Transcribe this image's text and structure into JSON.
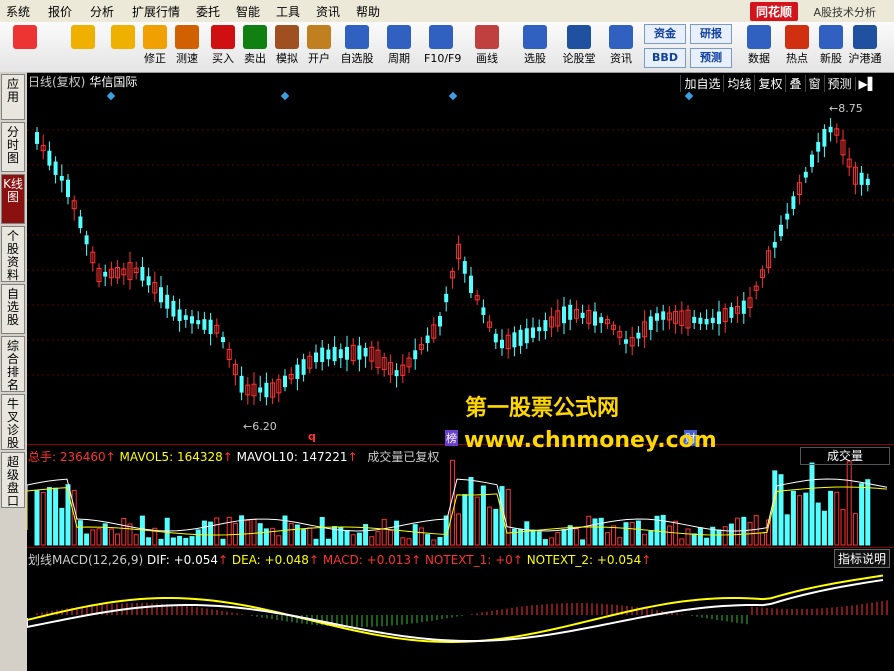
{
  "menu": [
    "系统",
    "报价",
    "分析",
    "扩展行情",
    "委托",
    "智能",
    "工具",
    "资讯",
    "帮助"
  ],
  "brand": "同花顺",
  "app_title": "A股技术分析",
  "toolbar": [
    {
      "label": "",
      "icon": "grid-icon",
      "color": "#e33"
    },
    {
      "label": "",
      "icon": "back-arrow-icon",
      "color": "#f0b000"
    },
    {
      "label": "",
      "icon": "up-down-arrow-icon",
      "color": "#f0b000"
    },
    {
      "label": "修正",
      "icon": "refresh-icon",
      "color": "#f0a000"
    },
    {
      "label": "测速",
      "icon": "clock-icon",
      "color": "#d06000"
    },
    {
      "label": "买入",
      "icon": "buy-icon",
      "color": "#d01010"
    },
    {
      "label": "卖出",
      "icon": "sell-icon",
      "color": "#108010"
    },
    {
      "label": "模拟",
      "icon": "hammer-icon",
      "color": "#a05020"
    },
    {
      "label": "开户",
      "icon": "lock-icon",
      "color": "#c08020"
    },
    {
      "label": "自选股",
      "icon": "star-folder-icon",
      "color": "#3060c0"
    },
    {
      "label": "周期",
      "icon": "period-icon",
      "color": "#3060c0"
    },
    {
      "label": "F10/F9",
      "icon": "f10-icon",
      "color": "#3060c0"
    },
    {
      "label": "画线",
      "icon": "pencil-icon",
      "color": "#c04040"
    },
    {
      "label": "选股",
      "icon": "filter-icon",
      "color": "#3060c0"
    },
    {
      "label": "论股堂",
      "icon": "forum-icon",
      "color": "#2050a0"
    },
    {
      "label": "资讯",
      "icon": "news-icon",
      "color": "#3060c0"
    },
    {
      "label": "数据",
      "icon": "pe-icon",
      "color": "#3060c0"
    },
    {
      "label": "热点",
      "icon": "hot-icon",
      "color": "#d03010"
    },
    {
      "label": "新股",
      "icon": "new-stock-icon",
      "color": "#3060c0"
    },
    {
      "label": "沪港通",
      "icon": "sse-hke-icon",
      "color": "#2050a0"
    }
  ],
  "toolbar_small": {
    "zijin": "资金",
    "bbd": "BBD",
    "yanbao": "研报",
    "yuce": "预测"
  },
  "sidebar": [
    {
      "label": "应用"
    },
    {
      "label": "分时图"
    },
    {
      "label": "K线图",
      "active": true
    },
    {
      "label": "个股资料"
    },
    {
      "label": "自选股"
    },
    {
      "label": "综合排名"
    },
    {
      "label": "牛叉诊股"
    },
    {
      "label": "超级盘口"
    }
  ],
  "chart": {
    "period": "日线(复权)",
    "stock_name": "华信国际",
    "buttons": [
      "加自选",
      "均线",
      "复权",
      "叠",
      "窗",
      "预测"
    ],
    "high_label": "8.75",
    "low_label": "6.20",
    "marker_q": "q",
    "marker_bang": "榜",
    "marker_cai": "财"
  },
  "volume": {
    "total_label": "总手: 236460",
    "mavol5": "MAVOL5: 164328",
    "mavol10": "MAVOL10: 147221",
    "note": "成交量已复权",
    "selector": "成交量"
  },
  "macd": {
    "title": "划线MACD(12,26,9)",
    "dif": "DIF: +0.054",
    "dea": "DEA: +0.048",
    "macd": "MACD: +0.013",
    "notext1": "NOTEXT_1: +0",
    "notext2": "NOTEXT_2: +0.054",
    "indicator_btn": "指标说明"
  },
  "watermark": {
    "line1": "第一股票公式网",
    "line2": "www.chnmoney.com"
  },
  "colors": {
    "up": "#ff3232",
    "down": "#54ffff",
    "dif": "#ffffff",
    "dea": "#ffff00",
    "vol_header_red": "#ff3232"
  }
}
